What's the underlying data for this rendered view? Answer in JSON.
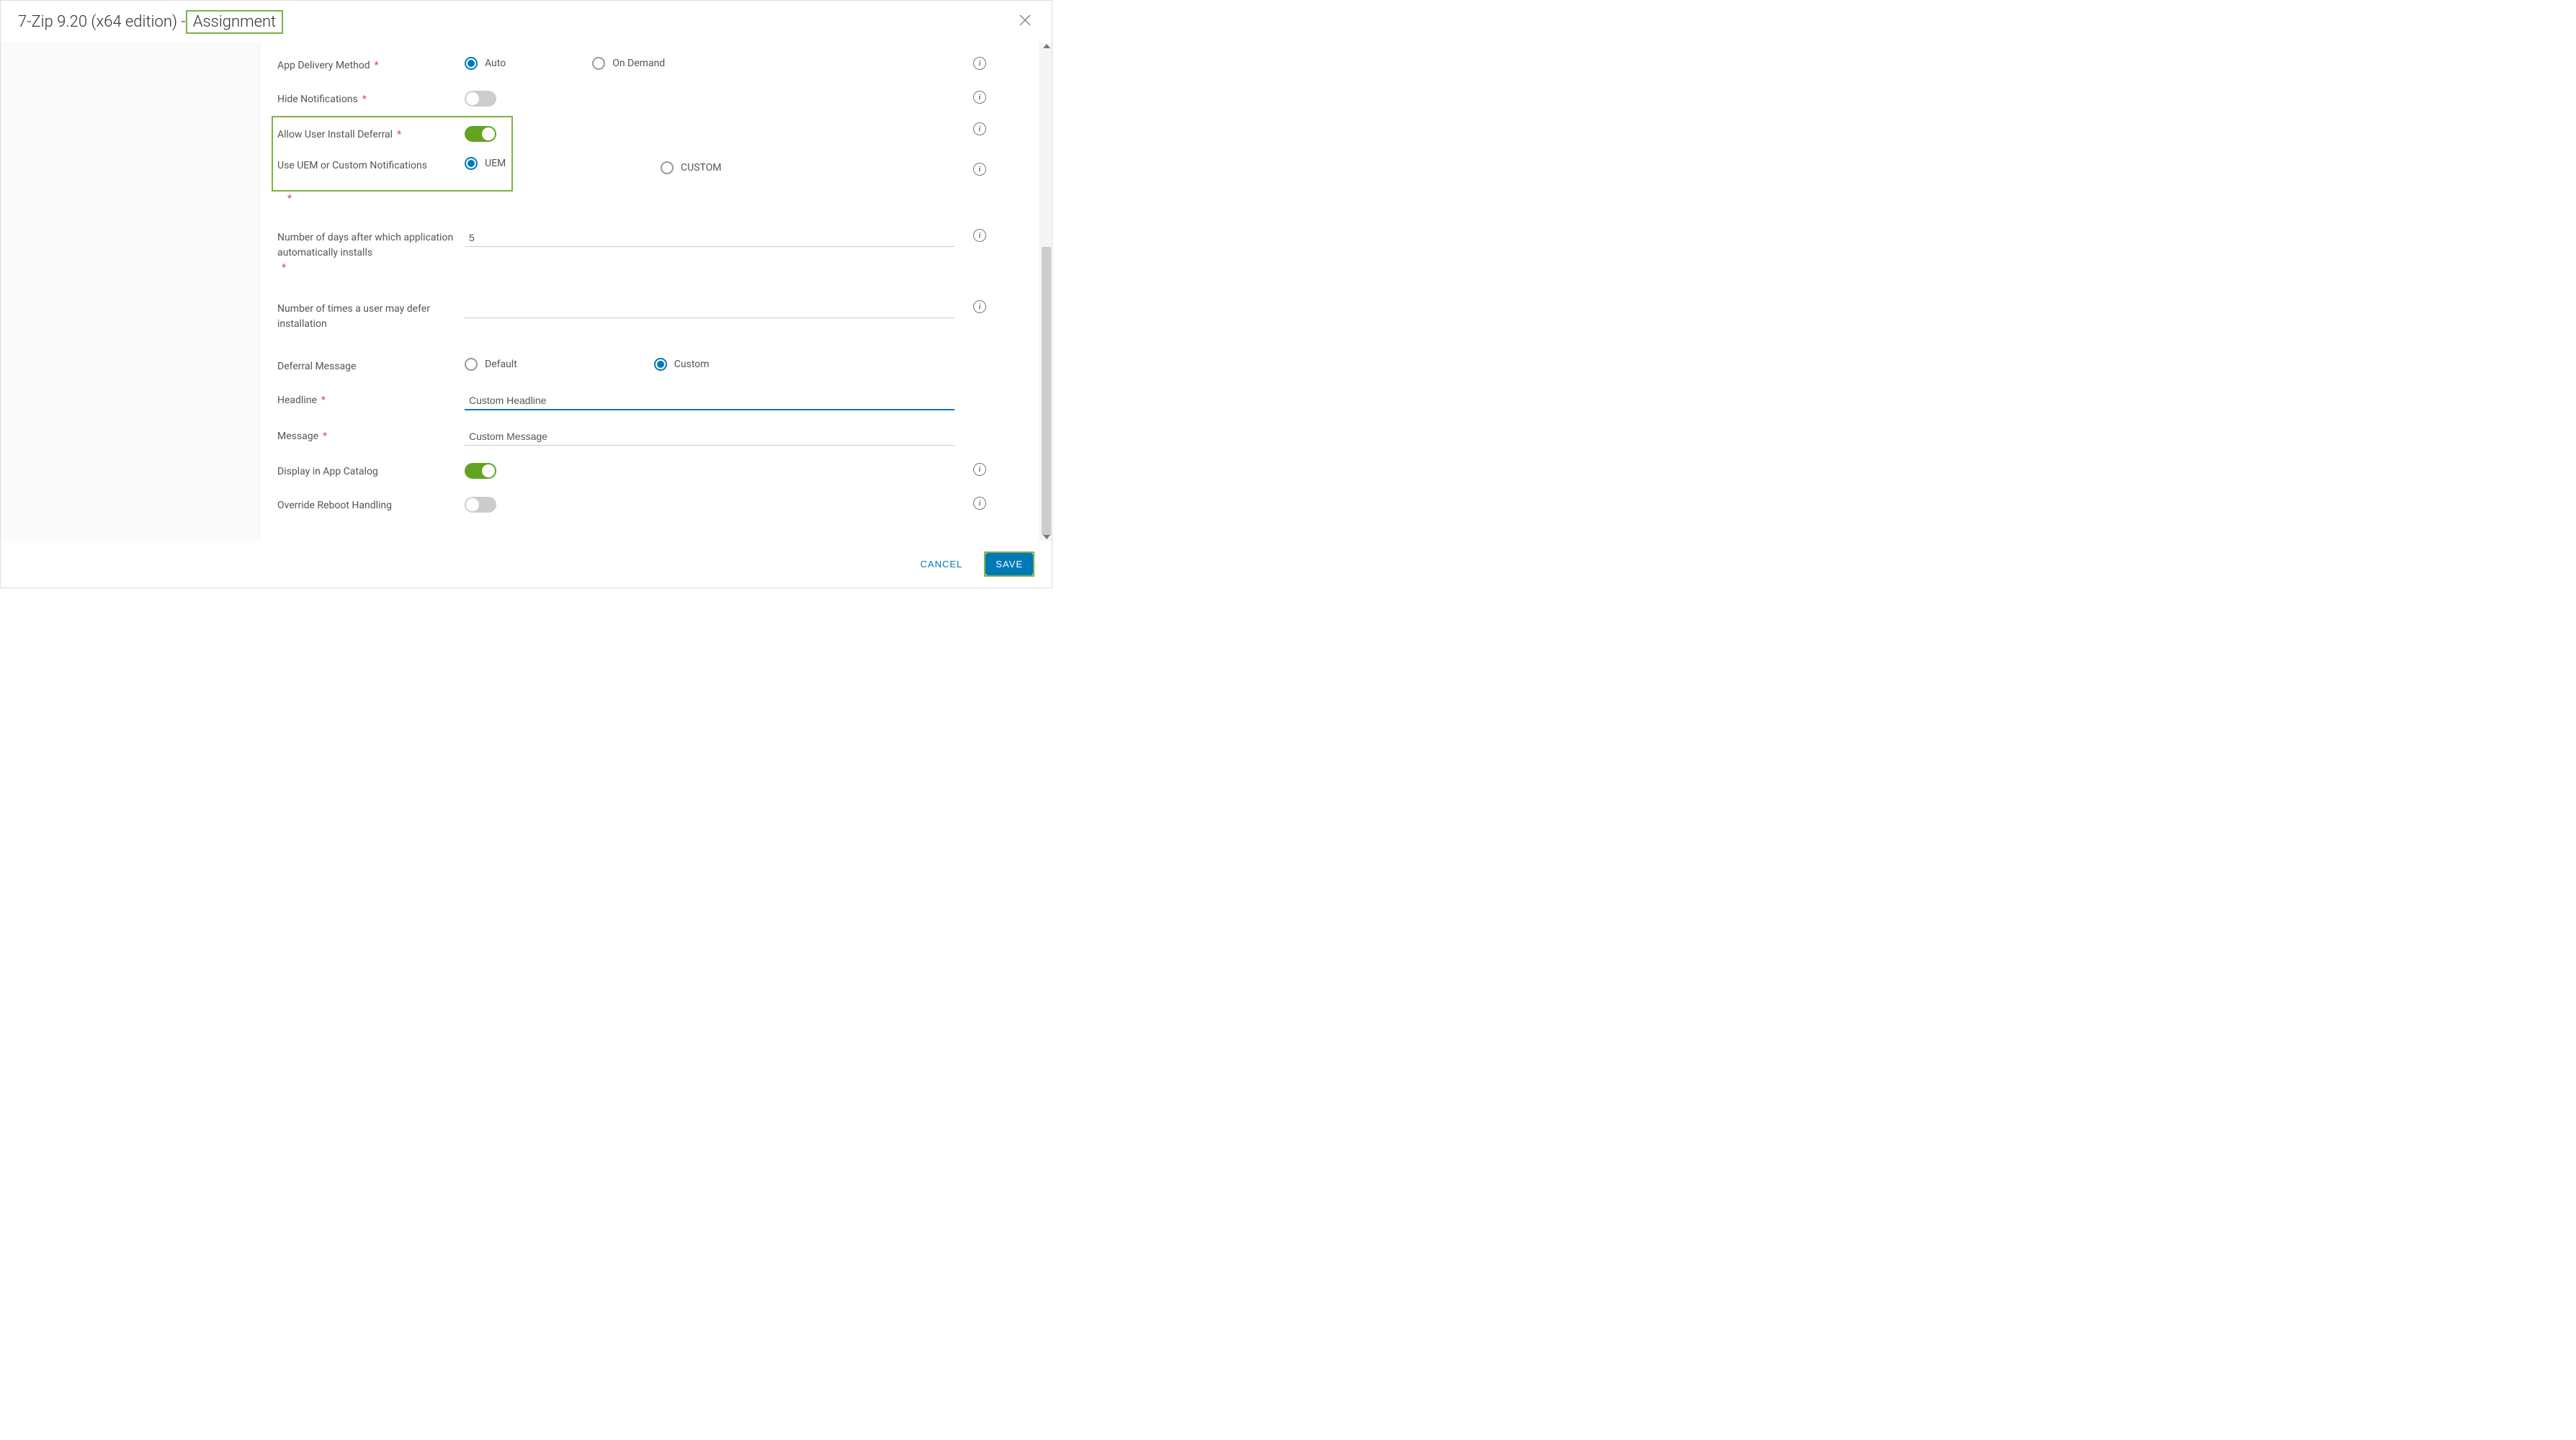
{
  "header": {
    "title_prefix": "7-Zip 9.20 (x64 edition) - ",
    "title_suffix": "Assignment"
  },
  "form": {
    "app_delivery": {
      "label": "App Delivery Method",
      "options": {
        "auto": "Auto",
        "on_demand": "On Demand"
      }
    },
    "hide_notifications": {
      "label": "Hide Notifications"
    },
    "allow_deferral": {
      "label": "Allow User Install Deferral"
    },
    "uem_custom": {
      "label": "Use UEM or Custom Notifications",
      "options": {
        "uem": "UEM",
        "custom": "CUSTOM"
      }
    },
    "days_auto_install": {
      "label": "Number of days after which application automatically installs",
      "value": "5"
    },
    "defer_times": {
      "label": "Number of times a user may defer installation",
      "value": ""
    },
    "deferral_message": {
      "label": "Deferral Message",
      "options": {
        "default": "Default",
        "custom": "Custom"
      }
    },
    "headline": {
      "label": "Headline",
      "value": "Custom Headline"
    },
    "message": {
      "label": "Message",
      "value": "Custom Message"
    },
    "display_catalog": {
      "label": "Display in App Catalog"
    },
    "override_reboot": {
      "label": "Override Reboot Handling"
    }
  },
  "footer": {
    "cancel": "CANCEL",
    "save": "SAVE"
  },
  "info_glyph": "i"
}
